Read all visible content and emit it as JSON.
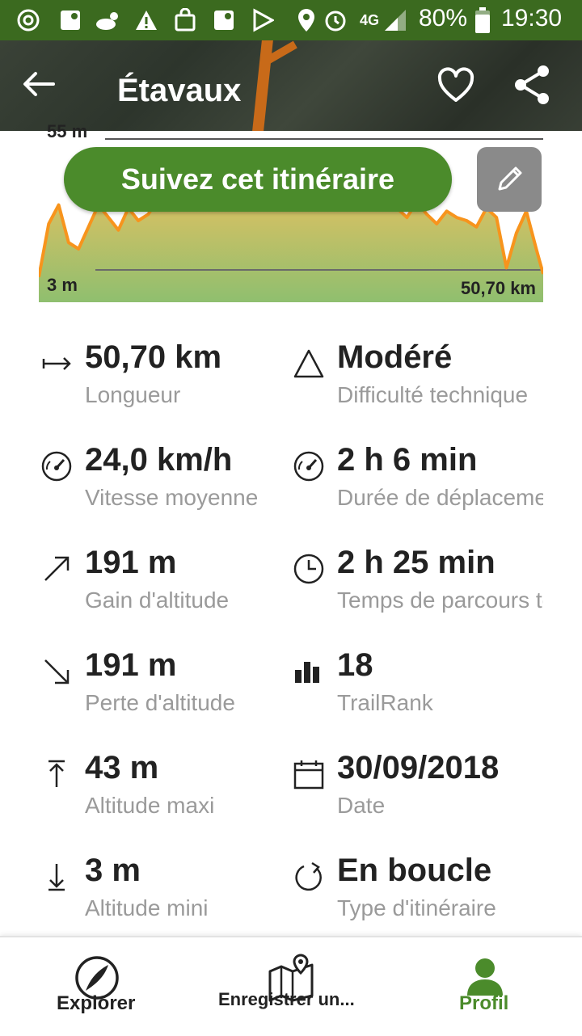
{
  "status_bar": {
    "battery": "80%",
    "time": "19:30",
    "network": "4G",
    "icons": [
      "sync-icon",
      "maps-notification-icon",
      "weather-night-icon",
      "warning-icon",
      "shopping-bag-icon",
      "maps-notification-icon",
      "play-store-icon",
      "location-icon",
      "alarm-icon",
      "network-4g-icon",
      "signal-icon",
      "battery-icon"
    ]
  },
  "header": {
    "title": "Étavaux"
  },
  "chart": {
    "top_label": "55 m",
    "min_label": "3 m",
    "distance_label": "50,70 km",
    "follow_button": "Suivez cet itinéraire"
  },
  "chart_data": {
    "type": "area",
    "xlabel": "",
    "ylabel": "",
    "xlim": [
      0,
      50.7
    ],
    "ylim": [
      3,
      55
    ],
    "x": [
      0,
      1,
      2,
      3,
      4,
      5,
      6,
      7,
      8,
      9,
      10,
      11,
      12,
      13,
      14,
      15,
      16,
      17,
      18,
      19,
      20,
      21,
      22,
      23,
      24,
      25,
      26,
      27,
      28,
      29,
      30,
      31,
      32,
      33,
      34,
      35,
      36,
      37,
      38,
      39,
      40,
      41,
      42,
      43,
      44,
      45,
      46,
      47,
      48,
      49,
      50,
      50.7
    ],
    "values": [
      11,
      28,
      34,
      22,
      20,
      27,
      34,
      30,
      26,
      33,
      29,
      31,
      36,
      42,
      38,
      40,
      37,
      43,
      39,
      41,
      42,
      38,
      40,
      42,
      39,
      43,
      41,
      40,
      38,
      42,
      40,
      39,
      37,
      40,
      38,
      35,
      33,
      30,
      35,
      31,
      28,
      32,
      30,
      29,
      27,
      33,
      30,
      14,
      25,
      32,
      20,
      12
    ]
  },
  "stats": [
    {
      "icon": "length-arrow-icon",
      "value": "50,70 km",
      "label": "Longueur"
    },
    {
      "icon": "difficulty-triangle-icon",
      "value": "Modéré",
      "label": "Difficulté technique"
    },
    {
      "icon": "speedometer-icon",
      "value": "24,0 km/h",
      "label": "Vitesse moyenne"
    },
    {
      "icon": "speedometer-icon",
      "value": "2 h 6 min",
      "label": "Durée de déplacement"
    },
    {
      "icon": "elevation-gain-icon",
      "value": "191 m",
      "label": "Gain d'altitude"
    },
    {
      "icon": "clock-icon",
      "value": "2 h 25 min",
      "label": "Temps de parcours total"
    },
    {
      "icon": "elevation-loss-icon",
      "value": "191 m",
      "label": "Perte d'altitude"
    },
    {
      "icon": "bar-chart-icon",
      "value": "18",
      "label": "TrailRank"
    },
    {
      "icon": "max-altitude-icon",
      "value": "43 m",
      "label": "Altitude maxi"
    },
    {
      "icon": "calendar-icon",
      "value": "30/09/2018",
      "label": "Date"
    },
    {
      "icon": "min-altitude-icon",
      "value": "3 m",
      "label": "Altitude mini"
    },
    {
      "icon": "loop-icon",
      "value": "En boucle",
      "label": "Type d'itinéraire"
    }
  ],
  "bottom_nav": [
    {
      "icon": "explore-icon",
      "label": "Explorer",
      "active": false
    },
    {
      "icon": "record-map-icon",
      "label": "Enregistrer un...",
      "active": false
    },
    {
      "icon": "profile-icon",
      "label": "Profil",
      "active": true
    }
  ],
  "colors": {
    "status_bar": "#3b6a1f",
    "accent_green": "#4b8b2b",
    "chart_line": "#f7941d",
    "chart_fill_top": "#e8c060",
    "chart_fill_bottom": "#8fbf6f",
    "label_gray": "#9a9a9a",
    "active_nav": "#4b8b2b"
  }
}
